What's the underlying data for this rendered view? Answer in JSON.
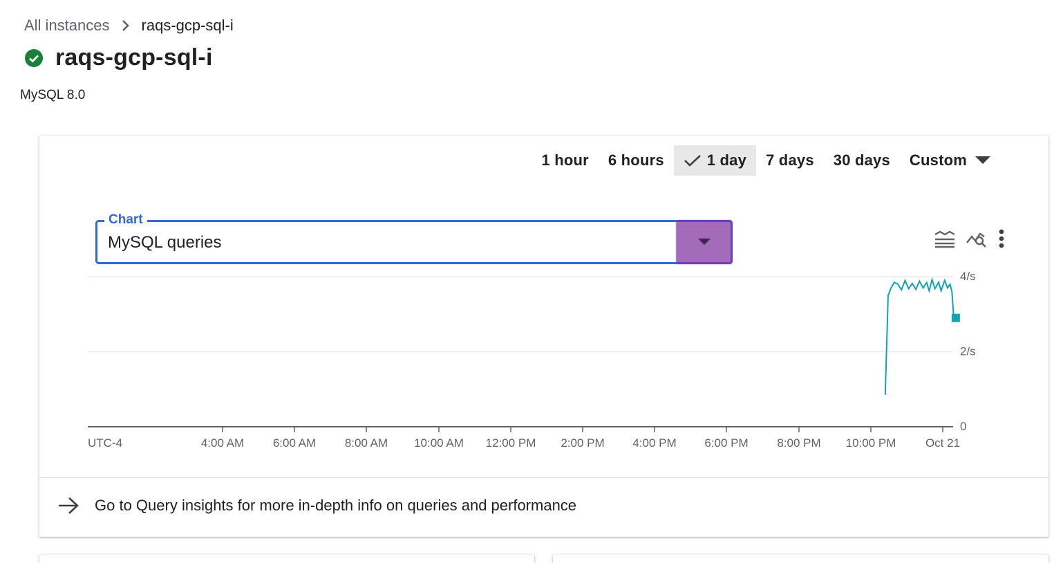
{
  "breadcrumb": {
    "parent": "All instances",
    "current": "raqs-gcp-sql-i"
  },
  "instance": {
    "name": "raqs-gcp-sql-i",
    "version": "MySQL 8.0",
    "status_icon": "check-circle-icon",
    "status_color": "#188038"
  },
  "time_range": {
    "options": [
      "1 hour",
      "6 hours",
      "1 day",
      "7 days",
      "30 days",
      "Custom"
    ],
    "selected": "1 day"
  },
  "chart_select": {
    "label": "Chart",
    "value": "MySQL queries"
  },
  "chart_tools": [
    "legend-lines-icon",
    "explore-chart-icon",
    "more-vert-icon"
  ],
  "chart_data": {
    "type": "line",
    "x_ticks": [
      "UTC-4",
      "4:00 AM",
      "6:00 AM",
      "8:00 AM",
      "10:00 AM",
      "12:00 PM",
      "2:00 PM",
      "4:00 PM",
      "6:00 PM",
      "8:00 PM",
      "10:00 PM",
      "Oct 21"
    ],
    "y_ticks": [
      "0",
      "2/s",
      "4/s"
    ],
    "ylim": [
      0,
      4
    ],
    "xlim": [
      0,
      24
    ],
    "grid": true,
    "series": [
      {
        "color": "#12a4af",
        "points": [
          [
            22.4,
            0.85
          ],
          [
            22.48,
            3.5
          ],
          [
            22.56,
            3.7
          ],
          [
            22.65,
            3.85
          ],
          [
            22.75,
            3.8
          ],
          [
            22.85,
            3.65
          ],
          [
            22.95,
            3.9
          ],
          [
            23.05,
            3.68
          ],
          [
            23.15,
            3.82
          ],
          [
            23.25,
            3.66
          ],
          [
            23.35,
            3.88
          ],
          [
            23.45,
            3.7
          ],
          [
            23.55,
            3.84
          ],
          [
            23.62,
            3.62
          ],
          [
            23.7,
            3.92
          ],
          [
            23.78,
            3.68
          ],
          [
            23.88,
            3.85
          ],
          [
            23.95,
            3.62
          ],
          [
            24.05,
            3.9
          ],
          [
            24.13,
            3.7
          ],
          [
            24.2,
            3.8
          ],
          [
            24.25,
            3.6
          ],
          [
            24.3,
            2.9
          ]
        ]
      }
    ]
  },
  "insights": {
    "text": "Go to Query insights for more in-depth info on queries and performance"
  }
}
